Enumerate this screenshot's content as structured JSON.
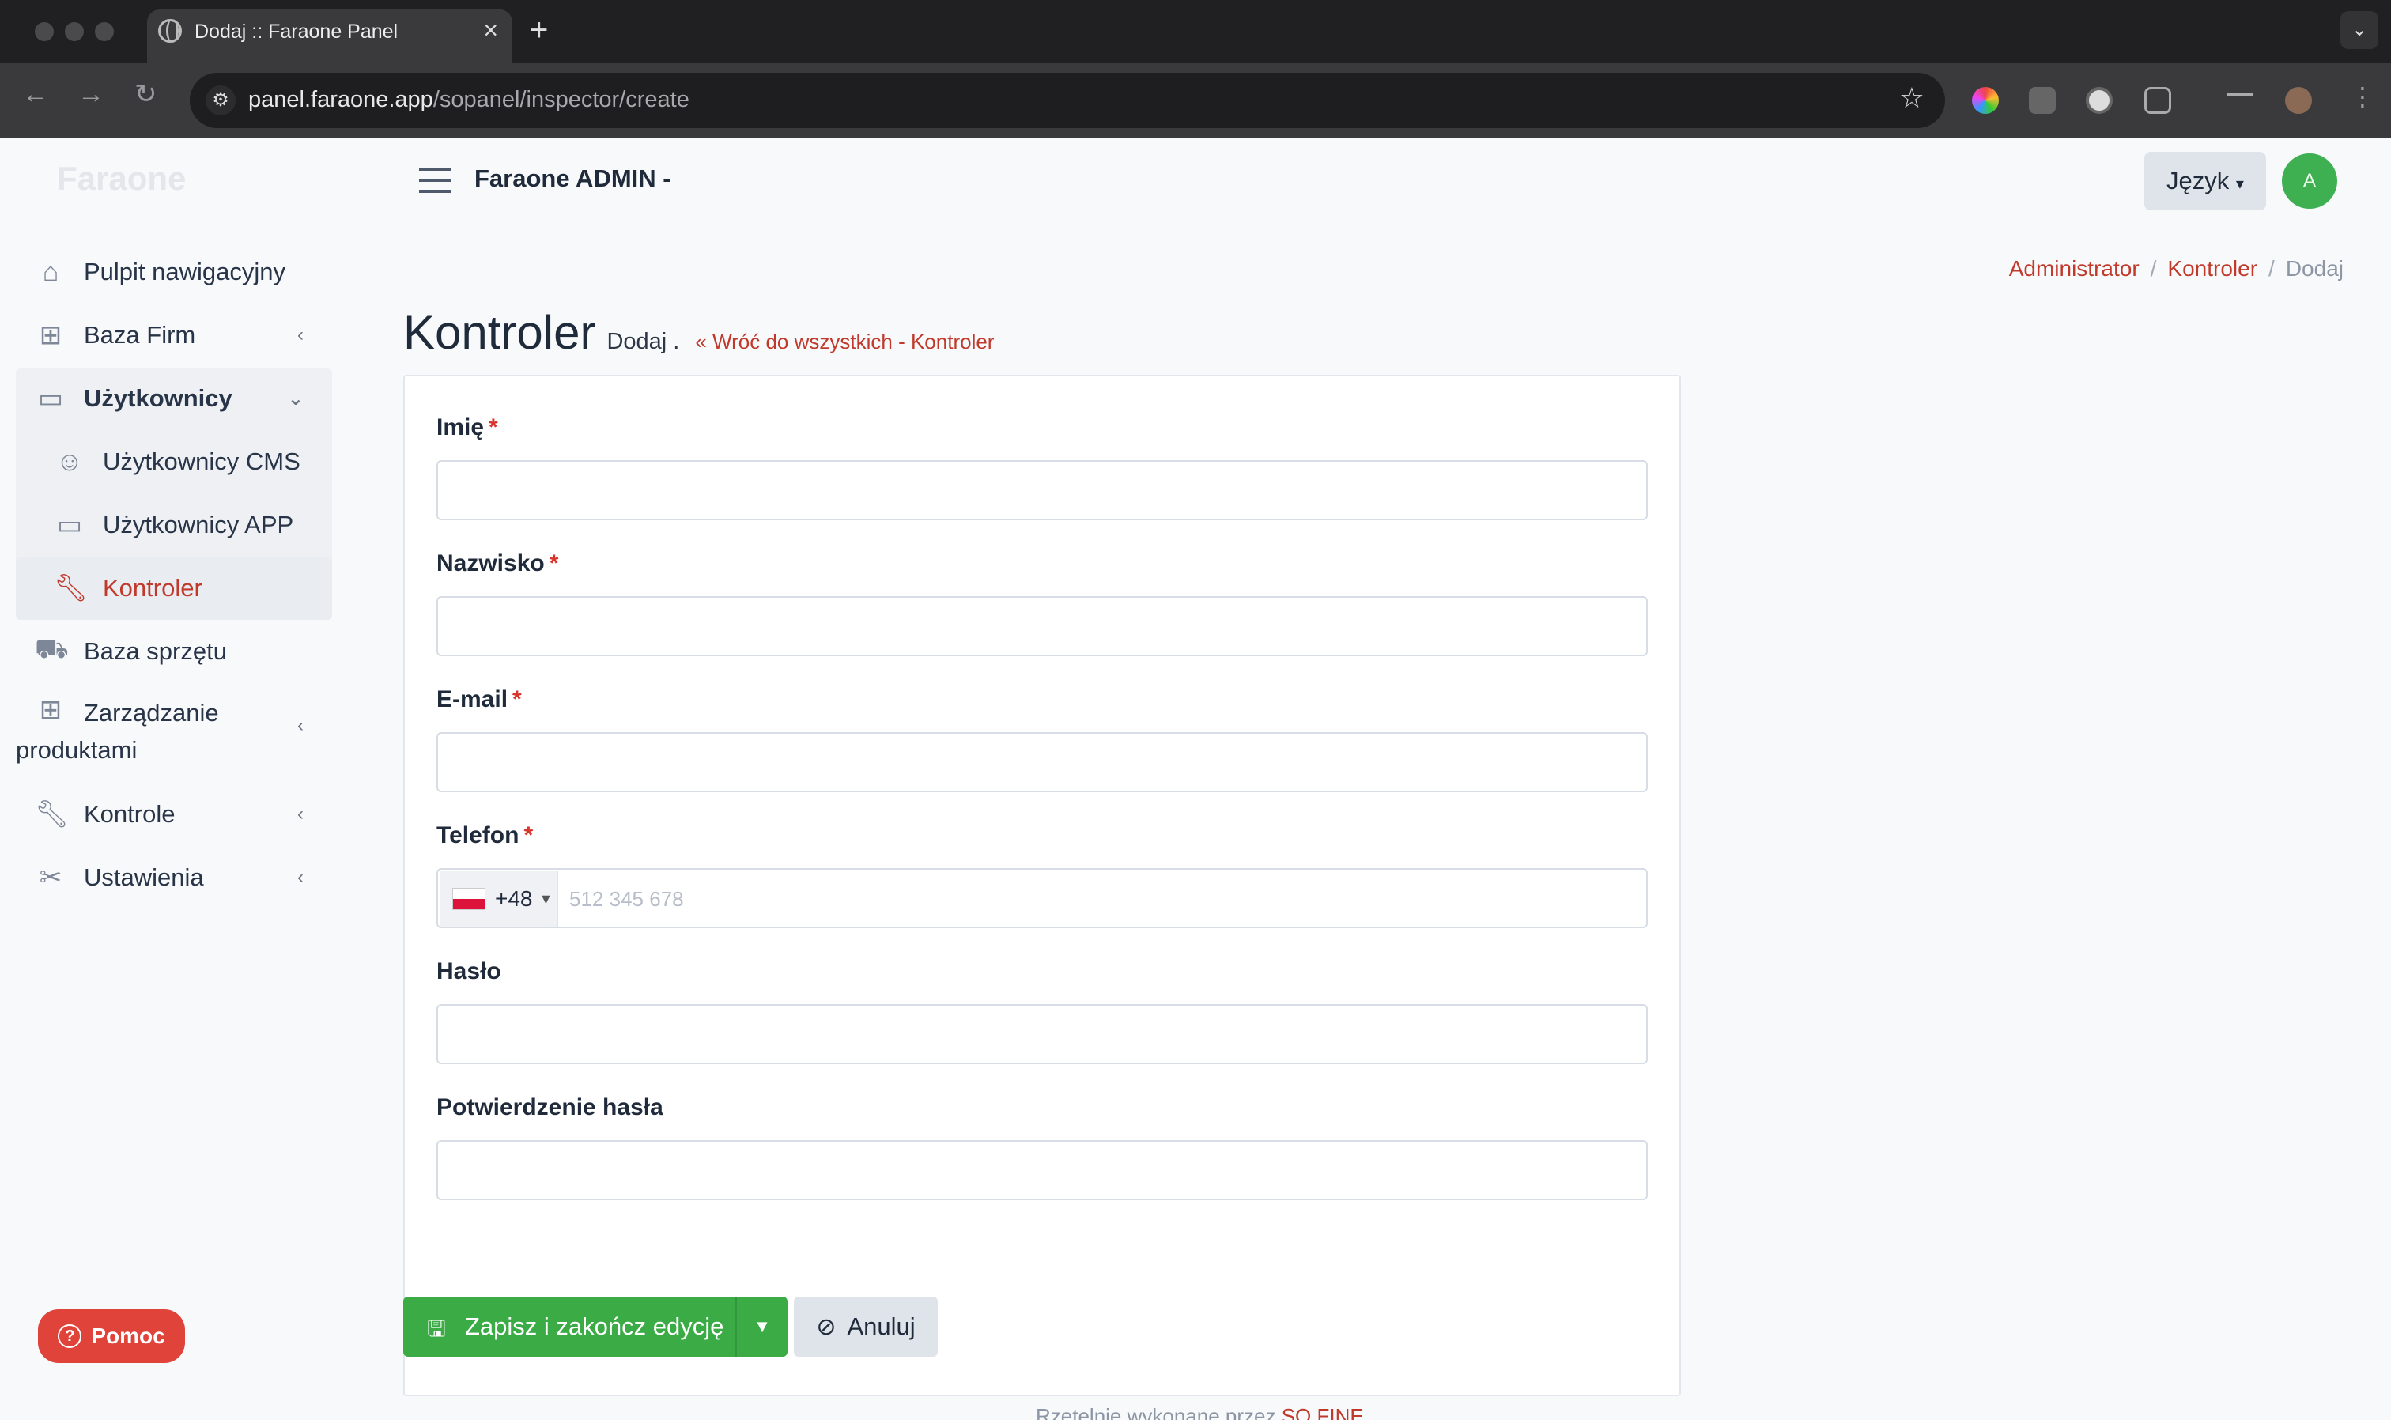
{
  "browser": {
    "tab_title": "Dodaj :: Faraone Panel",
    "url_host": "panel.faraone.app",
    "url_path": "/sopanel/inspector/create",
    "icons": [
      "back-arrow-icon",
      "forward-arrow-icon",
      "reload-icon",
      "site-settings-icon",
      "star-icon",
      "extension-icon",
      "profile-icon",
      "kebab-menu-icon"
    ]
  },
  "sidebar": {
    "logo": "Faraone",
    "items": [
      {
        "label": "Pulpit nawigacyjny",
        "icon": "home-icon"
      },
      {
        "label": "Baza Firm",
        "icon": "sitemap-icon"
      },
      {
        "label": "Użytkownicy",
        "icon": "briefcase-icon"
      },
      {
        "label": "Użytkownicy CMS",
        "icon": "user-icon"
      },
      {
        "label": "Użytkownicy APP",
        "icon": "briefcase-icon"
      },
      {
        "label": "Kontroler",
        "icon": "wrench-icon"
      },
      {
        "label": "Baza sprzętu",
        "icon": "dolly-icon"
      },
      {
        "label": "Zarządzanie produktami",
        "icon": "sitemap-icon"
      },
      {
        "label": "Kontrole",
        "icon": "wrench-icon"
      },
      {
        "label": "Ustawienia",
        "icon": "tools-icon"
      }
    ]
  },
  "header": {
    "title": "Faraone ADMIN -",
    "language_label": "Język",
    "avatar_initial": "A"
  },
  "breadcrumb": {
    "items": [
      "Administrator",
      "Kontroler",
      "Dodaj"
    ]
  },
  "page": {
    "title": "Kontroler",
    "subtitle": "Dodaj .",
    "back_link": "Wróć do wszystkich - Kontroler"
  },
  "form": {
    "first_name_label": "Imię",
    "last_name_label": "Nazwisko",
    "email_label": "E-mail",
    "phone_label": "Telefon",
    "phone_code": "+48",
    "phone_placeholder": "512 345 678",
    "password_label": "Hasło",
    "password_confirm_label": "Potwierdzenie hasła",
    "required_mark": "*"
  },
  "actions": {
    "save_label": "Zapisz i zakończ edycję",
    "cancel_label": "Anuluj"
  },
  "help": {
    "label": "Pomoc"
  },
  "footer": {
    "text": "Rzetelnie wykonane przez ",
    "link": "SO FINE"
  },
  "colors": {
    "accent_red": "#c0392b",
    "save_green": "#3aab45",
    "avatar_green": "#3fb052",
    "help_red": "#e0433a"
  }
}
